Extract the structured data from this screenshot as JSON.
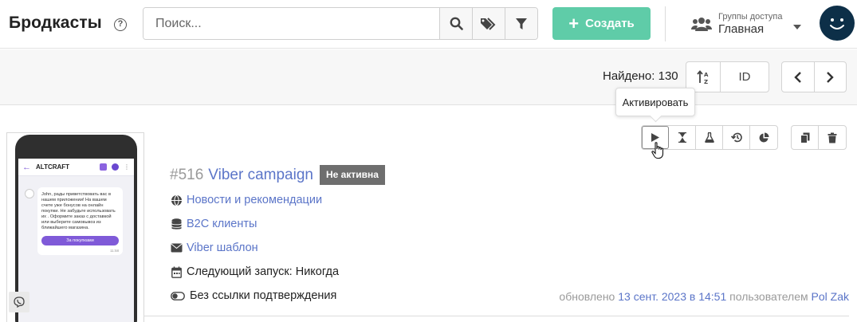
{
  "header": {
    "title": "Бродкасты",
    "help_symbol": "?",
    "search_placeholder": "Поиск...",
    "create_label": "Создать",
    "groups_label": "Группы доступа",
    "groups_value": "Главная"
  },
  "toolbar": {
    "found_text": "Найдено: 130",
    "sort_field": "ID"
  },
  "tooltip": {
    "text": "Активировать"
  },
  "card": {
    "id": "#516",
    "name": "Viber campaign",
    "status": "Не активна",
    "rows": [
      {
        "icon": "globe-icon",
        "text": "Новости и рекомендации"
      },
      {
        "icon": "database-icon",
        "text": "B2C клиенты"
      },
      {
        "icon": "envelope-icon",
        "text": "Viber шаблон"
      },
      {
        "icon": "calendar-icon",
        "text": "Следующий запуск: Никогда"
      },
      {
        "icon": "toggle-icon",
        "text": "Без ссылки подтверждения"
      }
    ],
    "updated_prefix": "обновлено",
    "updated_date": "13 сент. 2023 в 14:51",
    "updated_by_label": "пользователем",
    "updated_user": "Pol Zak"
  },
  "preview": {
    "brand": "ALTCRAFT",
    "message": "John, рады приветствовать вас в нашем приложении! На вашем счете уже бонусов на онлайн покупки. Не забудьте использовать их . Оформите заказ с доставкой или выберите самовывоз из ближайшего магазина.",
    "button": "За покупками",
    "time": "11:58"
  },
  "colors": {
    "accent_green": "#5fcca8",
    "link_blue": "#5b75c8",
    "status_gray": "#6e6e6e",
    "avatar_bg": "#0d2f48"
  }
}
